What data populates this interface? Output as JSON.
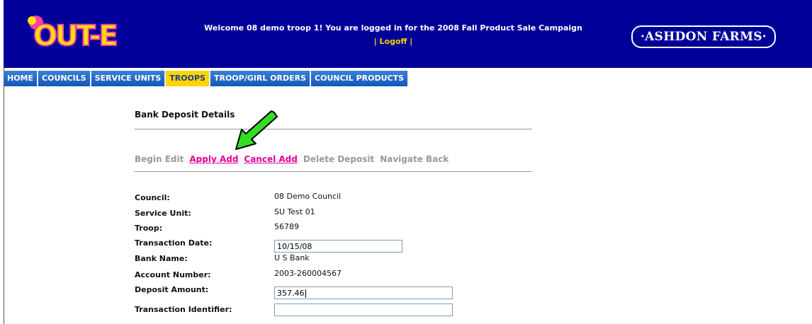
{
  "header": {
    "logo_text": "OUT-E",
    "welcome_line": "Welcome 08 demo troop 1! You are logged in for the 2008 Fall Product Sale Campaign",
    "logoff_label": "| Logoff |",
    "brand_label": "·ASHDON FARMS·"
  },
  "nav": {
    "items": [
      {
        "label": "HOME"
      },
      {
        "label": "COUNCILS"
      },
      {
        "label": "SERVICE UNITS"
      },
      {
        "label": "TROOPS"
      },
      {
        "label": "TROOP/GIRL ORDERS"
      },
      {
        "label": "COUNCIL PRODUCTS"
      }
    ],
    "active": "TROOPS"
  },
  "page": {
    "title": "Bank Deposit Details"
  },
  "actions": {
    "begin_edit": "Begin Edit",
    "apply_add": "Apply Add",
    "cancel_add": "Cancel Add",
    "delete_deposit": "Delete Deposit",
    "navigate_back": "Navigate Back"
  },
  "form": {
    "council_label": "Council:",
    "council_value": "08 Demo Council",
    "service_unit_label": "Service Unit:",
    "service_unit_value": "SU Test 01",
    "troop_label": "Troop:",
    "troop_value": "56789",
    "transaction_date_label": "Transaction Date:",
    "transaction_date_value": "10/15/08",
    "bank_name_label": "Bank Name:",
    "bank_name_value": "U S Bank",
    "account_number_label": "Account Number:",
    "account_number_value": "2003-260004567",
    "deposit_amount_label": "Deposit Amount:",
    "deposit_amount_value": "357.46",
    "transaction_identifier_label": "Transaction Identifier:",
    "transaction_identifier_value": ""
  },
  "colors": {
    "header_bg": "#000099",
    "nav_active": "#ffd400",
    "link": "#e0009a",
    "arrow": "#33dd22"
  }
}
